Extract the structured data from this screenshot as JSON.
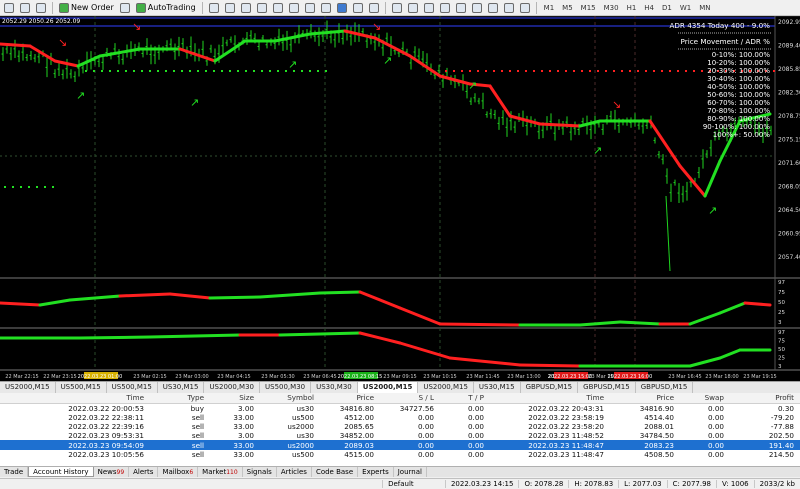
{
  "toolbar": {
    "new_order": "New Order",
    "auto_trading": "AutoTrading",
    "timeframes": [
      "M1",
      "M5",
      "M15",
      "M30",
      "H1",
      "H4",
      "D1",
      "W1",
      "MN"
    ]
  },
  "chart": {
    "top_price_label": "2052.29 2050.26 2052.09",
    "price_labels": [
      "2092.95",
      "2089.40",
      "2085.85",
      "2082.30",
      "2078.75",
      "2075.15",
      "2071.60",
      "2068.05",
      "2064.50",
      "2060.95",
      "2057.40"
    ],
    "osc1_labels": [
      "97",
      "75",
      "50",
      "25",
      "3"
    ],
    "osc2_labels": [
      "97",
      "75",
      "50",
      "25",
      "3"
    ],
    "time_labels": [
      "22 Mar 22:15",
      "22 Mar 23:15",
      "2022.03.23 01:00",
      "23 Mar 02:15",
      "23 Mar 03:00",
      "23 Mar 04:15",
      "23 Mar 05:30",
      "23 Mar 06:45",
      "2022.03.23 08:15",
      "23 Mar 09:15",
      "23 Mar 10:15",
      "23 Mar 11:45",
      "23 Mar 13:00",
      "23 Mar 14:15",
      "23 Mar 15:30",
      "2022.03.23 15:00",
      "2022.03.23 16:00",
      "23 Mar 16:45",
      "23 Mar 18:00",
      "23 Mar 19:15"
    ],
    "panel_title": "ADR 4354  Today 400 - 9.0%",
    "panel_subtitle": "Price Movement / ADR %",
    "adr_rows": [
      "0-10%: 100.00%",
      "10-20%: 100.00%",
      "20-30%: 100.00%",
      "30-40%: 100.00%",
      "40-50%: 100.00%",
      "50-60%: 100.00%",
      "60-70%: 100.00%",
      "70-80%: 100.00%",
      "80-90%: 100.00%",
      "90-100%: 100.00%",
      "100%+: 50.00%"
    ]
  },
  "chart_tabs": [
    "US2000,M15",
    "US500,M15",
    "US500,M15",
    "US30,M15",
    "US2000,M30",
    "US500,M30",
    "US30,M30",
    "US2000,M15",
    "US2000,M15",
    "US30,M15",
    "GBPUSD,M15",
    "GBPUSD,M15",
    "GBPUSD,M15"
  ],
  "history": {
    "columns": [
      "Time",
      "Type",
      "Size",
      "Symbol",
      "Price",
      "S / L",
      "T / P",
      "Time",
      "Price",
      "Swap",
      "Profit"
    ],
    "rows": [
      [
        "2022.03.22 20:00:53",
        "buy",
        "3.00",
        "us30",
        "34816.80",
        "34727.56",
        "0.00",
        "2022.03.22 20:43:31",
        "34816.90",
        "0.00",
        "0.30"
      ],
      [
        "2022.03.22 22:38:11",
        "sell",
        "33.00",
        "us500",
        "4512.00",
        "0.00",
        "0.00",
        "2022.03.22 23:58:19",
        "4514.40",
        "0.00",
        "-79.20"
      ],
      [
        "2022.03.22 22:39:16",
        "sell",
        "33.00",
        "us2000",
        "2085.65",
        "0.00",
        "0.00",
        "2022.03.22 23:58:20",
        "2088.01",
        "0.00",
        "-77.88"
      ],
      [
        "2022.03.23 09:53:31",
        "sell",
        "3.00",
        "us30",
        "34852.00",
        "0.00",
        "0.00",
        "2022.03.23 11:48:52",
        "34784.50",
        "0.00",
        "202.50"
      ],
      [
        "2022.03.23 09:54:09",
        "sell",
        "33.00",
        "us2000",
        "2089.03",
        "0.00",
        "0.00",
        "2022.03.23 11:48:47",
        "2083.23",
        "0.00",
        "191.40"
      ],
      [
        "2022.03.23 10:05:56",
        "sell",
        "33.00",
        "us500",
        "4515.00",
        "0.00",
        "0.00",
        "2022.03.23 11:48:47",
        "4508.50",
        "0.00",
        "214.50"
      ]
    ]
  },
  "bottom_tabs": [
    {
      "label": "Trade",
      "count": ""
    },
    {
      "label": "Account History",
      "count": ""
    },
    {
      "label": "News",
      "count": "99"
    },
    {
      "label": "Alerts",
      "count": ""
    },
    {
      "label": "Mailbox",
      "count": "6"
    },
    {
      "label": "Market",
      "count": "110"
    },
    {
      "label": "Signals",
      "count": ""
    },
    {
      "label": "Articles",
      "count": ""
    },
    {
      "label": "Code Base",
      "count": ""
    },
    {
      "label": "Experts",
      "count": ""
    },
    {
      "label": "Journal",
      "count": ""
    }
  ],
  "status": {
    "profile": "Default",
    "datetime": "2022.03.23 14:15",
    "open": "O: 2078.28",
    "high": "H: 2078.83",
    "low": "L: 2077.03",
    "close": "C: 2077.98",
    "volume": "V: 1006",
    "traffic": "2033/2 kb"
  },
  "colors": {
    "chart_bg": "#000000",
    "bull_line": "#22e022",
    "bear_line": "#ff2020",
    "selected_row": "#1e70d0"
  }
}
